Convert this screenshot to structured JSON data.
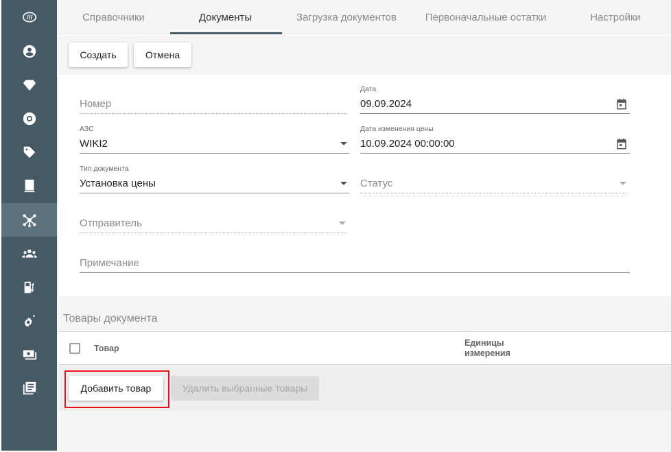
{
  "sidebar": {
    "items": [
      {
        "icon": "logo-icon"
      },
      {
        "icon": "user-icon"
      },
      {
        "icon": "diamond-icon"
      },
      {
        "icon": "lifebuoy-icon"
      },
      {
        "icon": "tag-icon"
      },
      {
        "icon": "receipt-icon"
      },
      {
        "icon": "network-icon",
        "active": true
      },
      {
        "icon": "users-icon"
      },
      {
        "icon": "fuel-station-icon"
      },
      {
        "icon": "settings-gear-icon"
      },
      {
        "icon": "money-icon"
      },
      {
        "icon": "document-list-icon"
      }
    ],
    "background": "#455a64"
  },
  "tabs": [
    {
      "label": "Справочники"
    },
    {
      "label": "Документы",
      "active": true
    },
    {
      "label": "Загрузка документов"
    },
    {
      "label": "Первоначальные остатки"
    },
    {
      "label": "Настройки"
    }
  ],
  "toolbar": {
    "create_label": "Создать",
    "cancel_label": "Отмена"
  },
  "form": {
    "number": {
      "placeholder": "Номер"
    },
    "date": {
      "label": "Дата",
      "value": "09.09.2024"
    },
    "station": {
      "label": "АЗС",
      "value": "WIKI2"
    },
    "price_change_date": {
      "label": "Дата изменения цены",
      "value": "10.09.2024 00:00:00"
    },
    "doc_type": {
      "label": "Тип документа",
      "value": "Установка цены"
    },
    "status": {
      "placeholder": "Статус"
    },
    "sender": {
      "placeholder": "Отправитель"
    },
    "note": {
      "placeholder": "Примечание"
    }
  },
  "goods": {
    "title": "Товары документа",
    "columns": {
      "product": "Товар",
      "unit_line1": "Единицы",
      "unit_line2": "измерения"
    },
    "add_label": "Добавить товар",
    "delete_label": "Удалить выбранные товары"
  },
  "colors": {
    "accent": "#455a64",
    "highlight": "#e8141c"
  }
}
